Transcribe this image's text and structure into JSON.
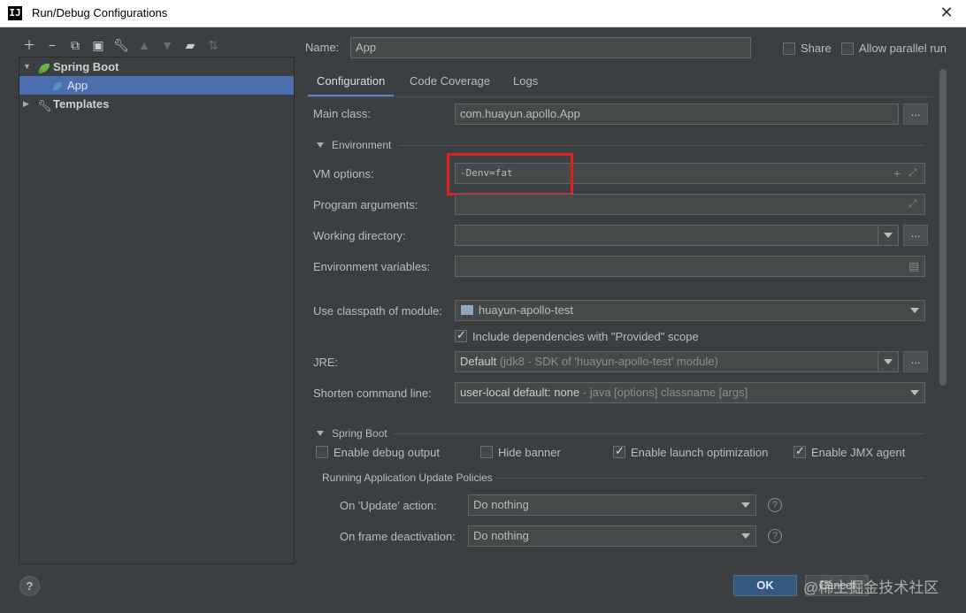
{
  "window": {
    "title": "Run/Debug Configurations",
    "app_icon": "IJ"
  },
  "toolbar": {
    "icons": [
      "plus-icon",
      "minus-icon",
      "copy-icon",
      "save-icon",
      "wrench-icon",
      "arrow-up-icon",
      "arrow-down-icon",
      "folder-icon",
      "sort-icon"
    ]
  },
  "tree": {
    "spring_boot": "Spring Boot",
    "app": "App",
    "templates": "Templates"
  },
  "header": {
    "name_label": "Name:",
    "name_value": "App",
    "share_label": "Share",
    "allow_parallel_label": "Allow parallel run"
  },
  "tabs": [
    "Configuration",
    "Code Coverage",
    "Logs"
  ],
  "config": {
    "main_class_label": "Main class:",
    "main_class_value": "com.huayun.apollo.App",
    "environment_label": "Environment",
    "vm_options_label": "VM options:",
    "vm_options_value": "-Denv=fat",
    "program_args_label": "Program arguments:",
    "working_dir_label": "Working directory:",
    "env_vars_label": "Environment variables:",
    "classpath_label": "Use classpath of module:",
    "classpath_value": "huayun-apollo-test",
    "include_deps_label": "Include dependencies with \"Provided\" scope",
    "jre_label": "JRE:",
    "jre_value_main": "Default",
    "jre_value_detail": "(jdk8 - SDK of 'huayun-apollo-test' module)",
    "shorten_label": "Shorten command line:",
    "shorten_value_main": "user-local default: none",
    "shorten_value_detail": "- java [options] classname [args]"
  },
  "spring_boot": {
    "section_label": "Spring Boot",
    "debug_output": "Enable debug output",
    "hide_banner": "Hide banner",
    "launch_opt": "Enable launch optimization",
    "jmx_agent": "Enable JMX agent",
    "policies_label": "Running Application Update Policies",
    "update_action_label": "On 'Update' action:",
    "update_action_value": "Do nothing",
    "frame_deactivation_label": "On frame deactivation:",
    "frame_deactivation_value": "Do nothing"
  },
  "footer": {
    "help": "?",
    "ok": "OK",
    "cancel": "Cancel",
    "watermark": "@稀土掘金技术社区"
  },
  "colors": {
    "accent": "#4a88c7",
    "selection": "#4b6eaf",
    "highlight_box": "#e02020",
    "ok_button": "#365880"
  }
}
